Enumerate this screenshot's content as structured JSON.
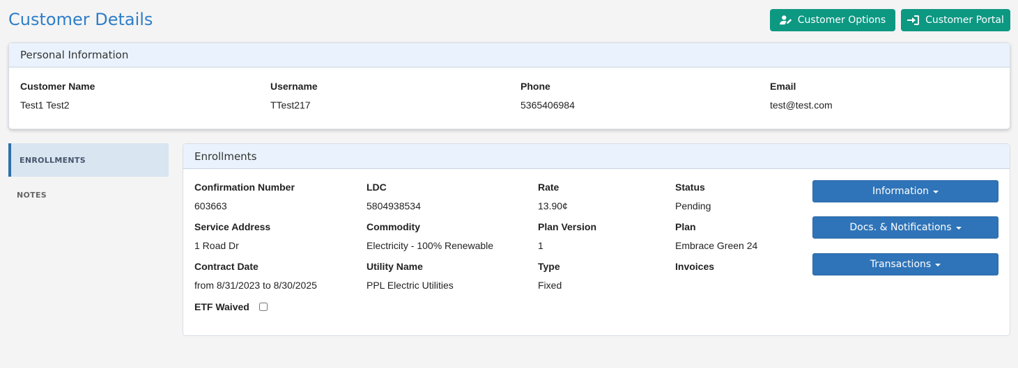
{
  "header": {
    "title": "Customer Details",
    "customer_options_label": "Customer Options",
    "customer_portal_label": "Customer Portal"
  },
  "personal": {
    "title": "Personal Information",
    "fields": [
      {
        "label": "Customer Name",
        "value": "Test1 Test2"
      },
      {
        "label": "Username",
        "value": "TTest217"
      },
      {
        "label": "Phone",
        "value": "5365406984"
      },
      {
        "label": "Email",
        "value": "test@test.com"
      }
    ]
  },
  "sidebar": {
    "items": [
      {
        "label": "ENROLLMENTS",
        "active": true
      },
      {
        "label": "NOTES",
        "active": false
      }
    ]
  },
  "enrollments": {
    "title": "Enrollments",
    "fields": [
      {
        "label": "Confirmation Number",
        "value": "603663"
      },
      {
        "label": "LDC",
        "value": "5804938534"
      },
      {
        "label": "Rate",
        "value": "13.90¢"
      },
      {
        "label": "Status",
        "value": "Pending"
      },
      {
        "label": "Service Address",
        "value": "1 Road Dr"
      },
      {
        "label": "Commodity",
        "value": "Electricity - 100% Renewable"
      },
      {
        "label": "Plan Version",
        "value": "1"
      },
      {
        "label": "Plan",
        "value": "Embrace Green 24"
      },
      {
        "label": "Contract Date",
        "value": "from 8/31/2023 to 8/30/2025"
      },
      {
        "label": "Utility Name",
        "value": "PPL Electric Utilities"
      },
      {
        "label": "Type",
        "value": "Fixed"
      },
      {
        "label": "Invoices",
        "value": ""
      }
    ],
    "etf_label": "ETF Waived",
    "etf_checked": false,
    "actions": {
      "information": "Information",
      "docs": "Docs. & Notifications",
      "transactions": "Transactions"
    }
  },
  "colors": {
    "title": "#2f7ec8",
    "teal_button": "#0d9882",
    "blue_button": "#2f74b8",
    "card_header": "#eaf3fd"
  }
}
